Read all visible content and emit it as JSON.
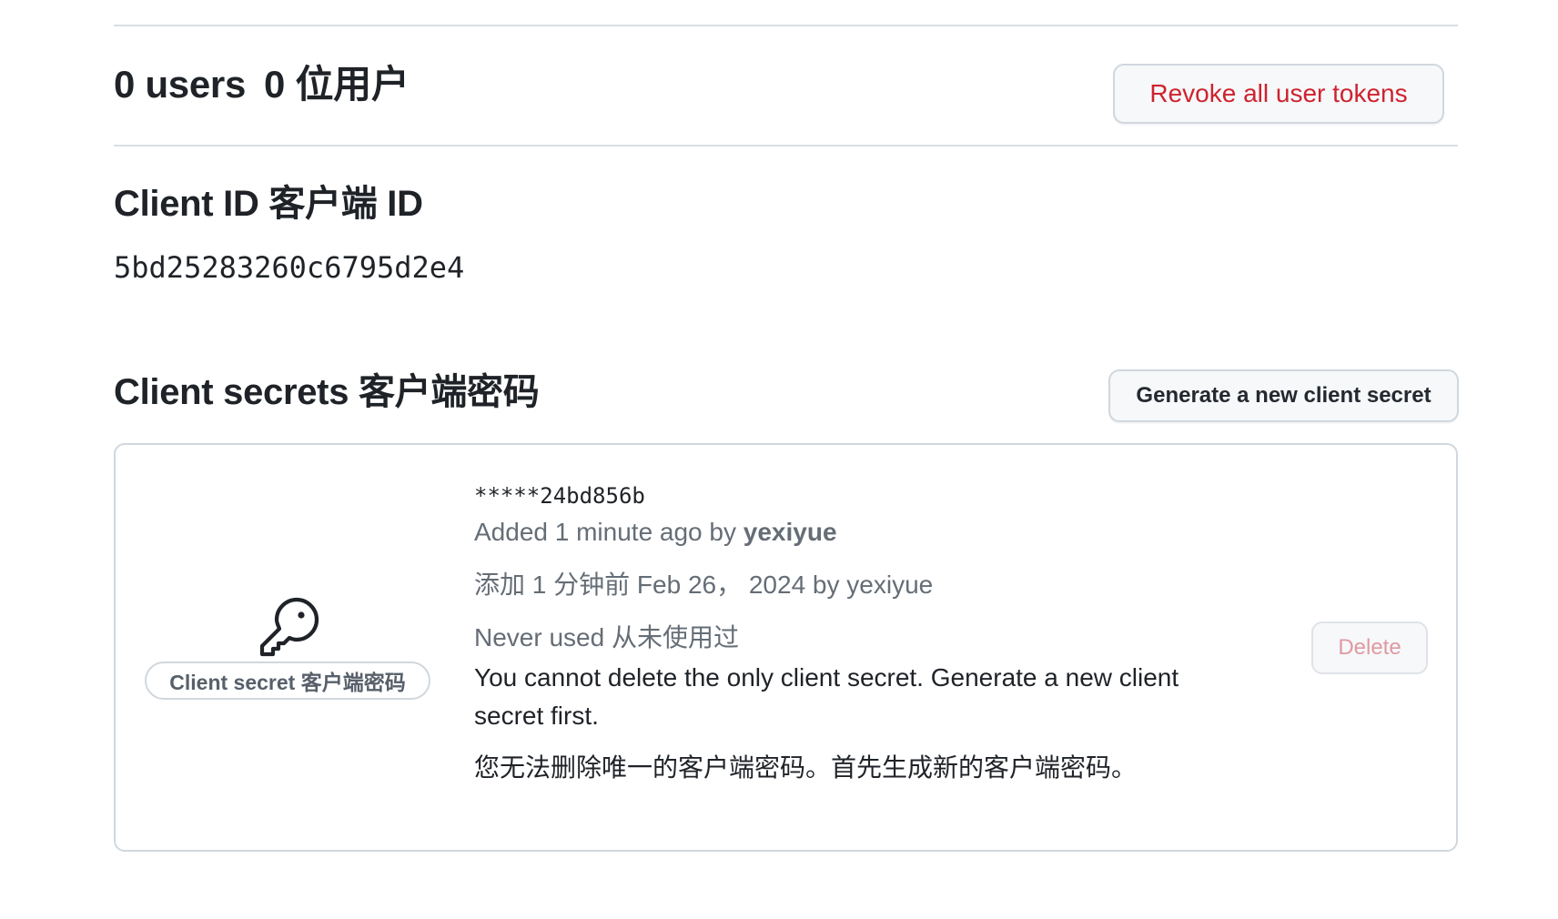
{
  "users_section": {
    "count": "0",
    "label_en": "users",
    "label_cn": "0 位用户",
    "revoke_button": "Revoke all user tokens"
  },
  "client_id": {
    "heading": "Client ID 客户端 ID",
    "value": "5bd25283260c6795d2e4"
  },
  "client_secrets": {
    "heading": "Client secrets 客户端密码",
    "generate_button": "Generate a new client secret",
    "secret": {
      "icon": "key-icon",
      "label": "Client secret  客户端密码",
      "masked_value": "*****24bd856b",
      "added_prefix": "Added 1 minute ago by ",
      "added_author": "yexiyue",
      "added_cn": "添加 1 分钟前 Feb 26， 2024 by yexiyue",
      "usage": "Never used  从未使用过",
      "warning_en": "You cannot delete the only client secret. Generate a new client secret first.",
      "warning_cn": "您无法删除唯一的客户端密码。首先生成新的客户端密码。",
      "delete_button": "Delete"
    }
  },
  "colors": {
    "danger": "#cf222e",
    "muted_text": "#656d76",
    "border": "#d0d7de"
  }
}
